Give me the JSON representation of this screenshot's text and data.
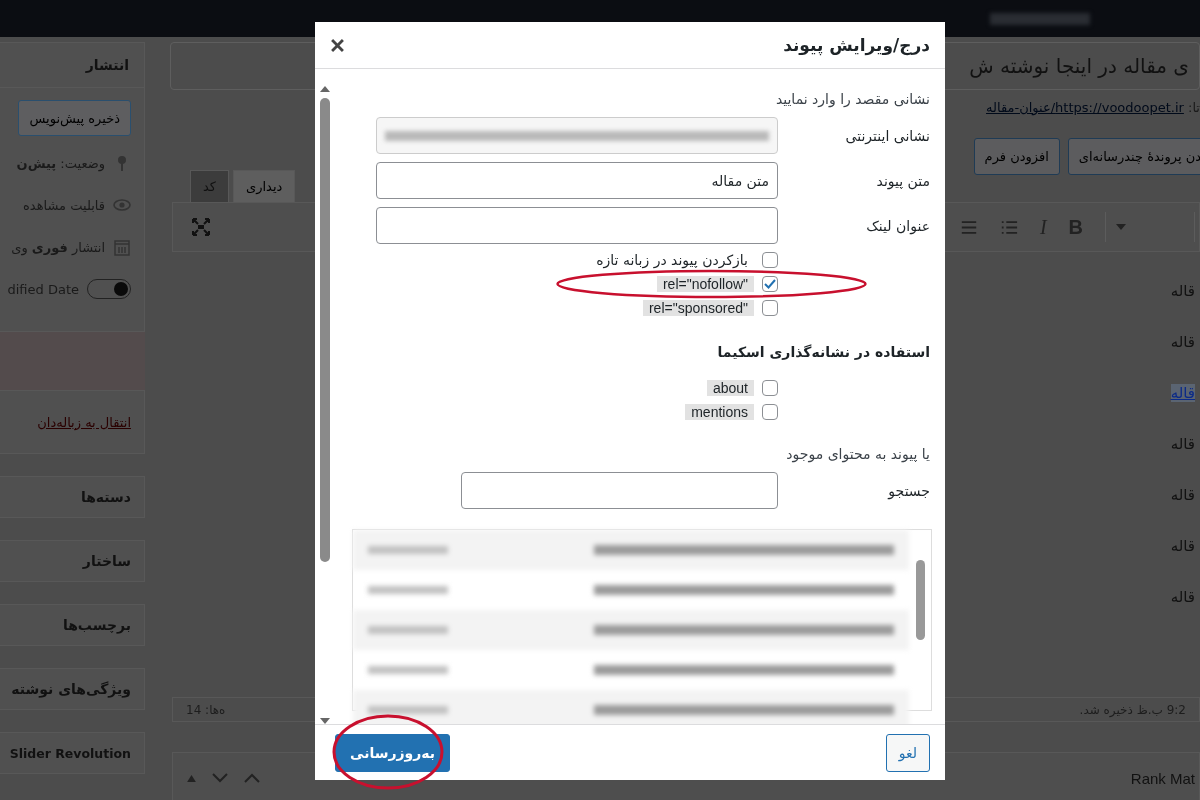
{
  "sidebar": {
    "publish_box": {
      "title": "انتشار",
      "save_draft_button": "ذخیره پیش‌نویس",
      "rows": [
        {
          "kind": "status",
          "text": "وضعیت: **پیش‌ن**"
        },
        {
          "kind": "visibility",
          "text": "قابلیت مشاهده"
        },
        {
          "kind": "schedule",
          "text": "انتشار **فوری** وی"
        }
      ],
      "modified_date": {
        "label": "dified Date",
        "on": true
      }
    },
    "trash_link": "انتقال به زباله‌دان",
    "boxes": [
      "دسته‌ها",
      "ساختار",
      "برچسب‌ها",
      "ویژگی‌های نوشته",
      "Slider Revolution"
    ]
  },
  "editor": {
    "title": "ی مقاله در اینجا نوشته ش",
    "permalink_label": "تا:",
    "permalink": "https://voodoopet.ir/عنوان-مقاله",
    "media_buttons": [
      "دن پروندهٔ چندرسانه‌ای",
      "افزودن فرم"
    ],
    "tabs": [
      {
        "label": "دیداری",
        "selected": true
      },
      {
        "label": "کد",
        "selected": false
      }
    ],
    "format_buttons": [
      "B",
      "I"
    ],
    "content_lines": [
      {
        "text": "قاله",
        "link": false
      },
      {
        "text": "قاله",
        "link": false
      },
      {
        "text": "قاله",
        "link": true
      },
      {
        "text": "قاله",
        "link": false
      },
      {
        "text": "قاله",
        "link": false
      },
      {
        "text": "قاله",
        "link": false
      },
      {
        "text": "قاله",
        "link": false
      }
    ],
    "status": "9:2 ب.ظ ذخیره شد.",
    "word_count": "ه‌ها: 14"
  },
  "bottom_box": {
    "title": "Rank Mat"
  },
  "modal": {
    "title": "درج/ویرایش پیوند",
    "intro": "نشانی مقصد را وارد نمایید",
    "fields": [
      {
        "kind": "redacted",
        "label": "نشانی اینترنتی"
      },
      {
        "kind": "text",
        "label": "متن پیوند",
        "value": "متن مقاله"
      },
      {
        "kind": "text",
        "label": "عنوان لینک"
      }
    ],
    "options": [
      {
        "label": "بازکردن پیوند در زبانه تازه",
        "checked": false,
        "highlighted": false
      },
      {
        "label": "rel=\"nofollow\"",
        "checked": true,
        "highlighted": true
      },
      {
        "label": "rel=\"sponsored\"",
        "checked": false,
        "highlighted": true
      }
    ],
    "schema_heading": "استفاده در نشانه‌گذاری اسکیما",
    "schema_options": [
      {
        "label": "about",
        "checked": false,
        "highlighted": true
      },
      {
        "label": "mentions",
        "checked": false,
        "highlighted": true
      }
    ],
    "existing_heading": "یا پیوند به محتوای موجود",
    "search_label": "جستجو",
    "update_button": "به‌روزرسانی",
    "cancel_button": "لغو"
  }
}
